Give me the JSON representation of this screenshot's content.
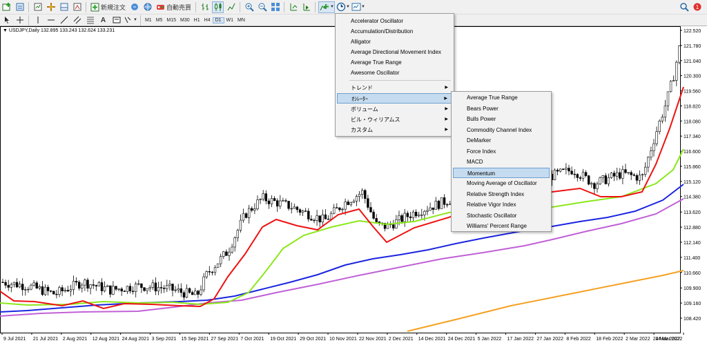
{
  "toolbar": {
    "new_order_label": "新規注文",
    "auto_trade_label": "自動売買",
    "timeframes": [
      "M1",
      "M5",
      "M15",
      "M30",
      "H1",
      "H4",
      "D1",
      "W1",
      "MN"
    ],
    "active_timeframe": "D1"
  },
  "chart": {
    "symbol_info": "USDJPY,Daily  132.895 133.243 132.624 133.231",
    "price_ticks": [
      "122.520",
      "121.780",
      "121.040",
      "120.300",
      "119.560",
      "118.820",
      "118.080",
      "117.340",
      "116.600",
      "115.860",
      "115.120",
      "114.380",
      "113.620",
      "112.880",
      "112.140",
      "111.400",
      "110.660",
      "109.900",
      "109.160",
      "108.420"
    ],
    "date_ticks": [
      "9 Jul 2021",
      "21 Jul 2021",
      "2 Aug 2021",
      "12 Aug 2021",
      "24 Aug 2021",
      "3 Sep 2021",
      "15 Sep 2021",
      "27 Sep 2021",
      "7 Oct 2021",
      "19 Oct 2021",
      "29 Oct 2021",
      "10 Nov 2021",
      "22 Nov 2021",
      "2 Dec 2021",
      "14 Dec 2021",
      "24 Dec 2021",
      "5 Jan 2022",
      "17 Jan 2022",
      "27 Jan 2022",
      "8 Feb 2022",
      "18 Feb 2022",
      "2 Mar 2022",
      "14 Mar 2022",
      "24 Mar 2022"
    ],
    "colors": {
      "ma_red": "#ee1111",
      "ma_green": "#8ae81a",
      "ma_blue": "#1a24e0",
      "ma_violet": "#c060d6",
      "ma_orange": "#f5a020",
      "candle": "#000000"
    }
  },
  "indicator_menu": {
    "items": [
      "Accelerator Oscillator",
      "Accumulation/Distribution",
      "Alligator",
      "Average Directional Movement Index",
      "Average True Range",
      "Awesome Oscillator"
    ],
    "submenus": [
      "トレンド",
      "ｵｼﾚｰﾀｰ",
      "ボリューム",
      "ビル・ウィリアムス",
      "カスタム"
    ],
    "highlighted_submenu": "ｵｼﾚｰﾀｰ"
  },
  "oscillator_menu": {
    "items": [
      "Average True Range",
      "Bears Power",
      "Bulls Power",
      "Commodity Channel Index",
      "DeMarker",
      "Force Index",
      "MACD",
      "Momentum",
      "Moving Average of Oscillator",
      "Relative Strength Index",
      "Relative Vigor Index",
      "Stochastic Oscillator",
      "Williams' Percent Range"
    ],
    "highlighted": "Momentum"
  },
  "icons": [
    "new-chart-icon",
    "profiles-icon",
    "market-watch-icon",
    "navigator-icon",
    "terminal-icon",
    "strategy-tester-icon",
    "new-order-icon",
    "metaeditor-icon",
    "auto-trading-icon",
    "bar-chart-icon",
    "candlestick-icon",
    "line-chart-icon",
    "zoom-in-icon",
    "zoom-out-icon",
    "tile-windows-icon",
    "chart-shift-icon",
    "autoscroll-icon",
    "indicators-icon",
    "periods-icon",
    "templates-icon",
    "cursor-icon",
    "crosshair-icon",
    "vertical-line-icon",
    "horizontal-line-icon",
    "trendline-icon",
    "channel-icon",
    "fibonacci-icon",
    "text-icon",
    "text-label-icon",
    "shapes-icon",
    "search-icon",
    "notification-icon"
  ]
}
